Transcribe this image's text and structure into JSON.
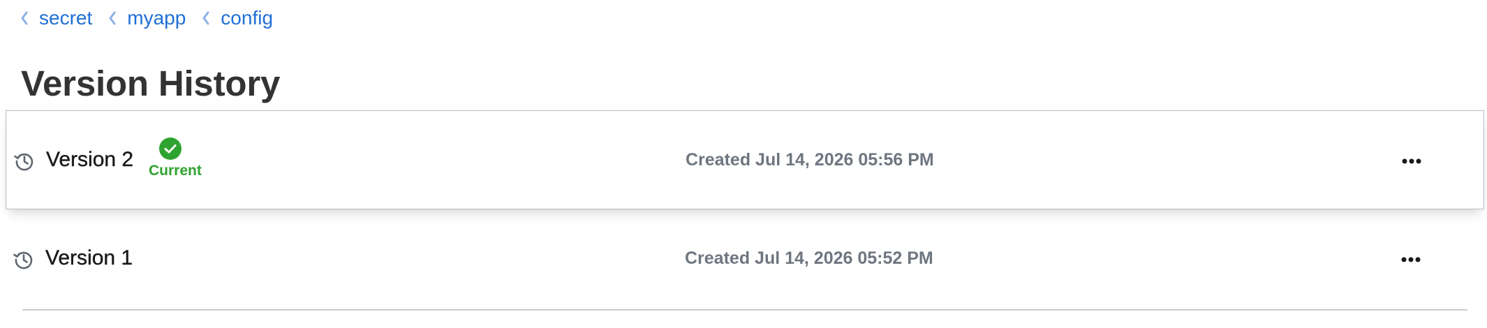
{
  "breadcrumb": {
    "items": [
      {
        "label": "secret"
      },
      {
        "label": "myapp"
      },
      {
        "label": "config"
      }
    ],
    "icon": "chevron-left-icon"
  },
  "page": {
    "title": "Version History"
  },
  "versions": [
    {
      "name": "Version 2",
      "status": "Current",
      "created": "Created Jul 14, 2026 05:56 PM",
      "selected": true,
      "icon": "history-icon",
      "status_icon": "check-circle-icon",
      "menu_icon": "more-horizontal-icon"
    },
    {
      "name": "Version 1",
      "created": "Created Jul 14, 2026 05:52 PM",
      "selected": false,
      "icon": "history-icon",
      "menu_icon": "more-horizontal-icon"
    }
  ],
  "colors": {
    "link": "#1f6fd6",
    "success": "#2fa32f",
    "muted_text": "#6f7680",
    "border": "#b8bcc3"
  }
}
